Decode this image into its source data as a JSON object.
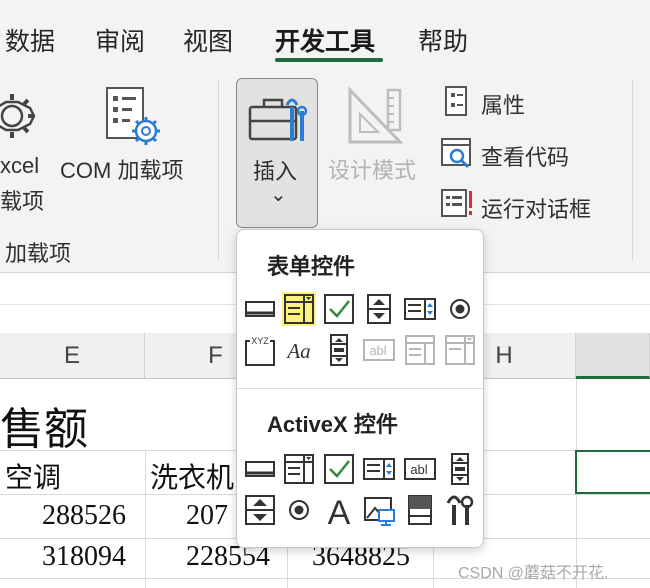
{
  "ribbon_tabs": [
    "数据",
    "审阅",
    "视图",
    "开发工具",
    "帮助"
  ],
  "ribbon": {
    "excel_addins_label_1": "xcel",
    "excel_addins_label_2": "载项",
    "com_addins_label": "COM 加载项",
    "group_label": "加载项",
    "insert_label": "插入",
    "insert_chevron": "⌄",
    "design_mode_label": "设计模式",
    "properties_label": "属性",
    "view_code_label": "查看代码",
    "run_dialog_label": "运行对话框"
  },
  "dropdown": {
    "form_controls_title": "表单控件",
    "activex_title": "ActiveX 控件",
    "form_controls": [
      "button",
      "combo-box",
      "check-box",
      "spin-button",
      "list-box",
      "option-button",
      "group-box",
      "label",
      "scroll-bar",
      "text-field",
      "combo-list-edit",
      "combo-dropdown-edit"
    ],
    "activex_controls": [
      "command-button",
      "combo-box",
      "check-box",
      "list-box",
      "text-box",
      "scroll-bar",
      "spin-button",
      "option-button",
      "label",
      "image",
      "toggle-button",
      "more-controls"
    ]
  },
  "sheet": {
    "col_e": "E",
    "col_f": "F",
    "col_h": "H",
    "title_fragment": "售额",
    "header_e": "空调",
    "header_f": "洗衣机",
    "row1_e": "288526",
    "row1_f": "207",
    "row2_e": "318094",
    "row2_f": "228554",
    "row2_g": "3648825"
  },
  "watermark": "CSDN @蘑菇不开花."
}
